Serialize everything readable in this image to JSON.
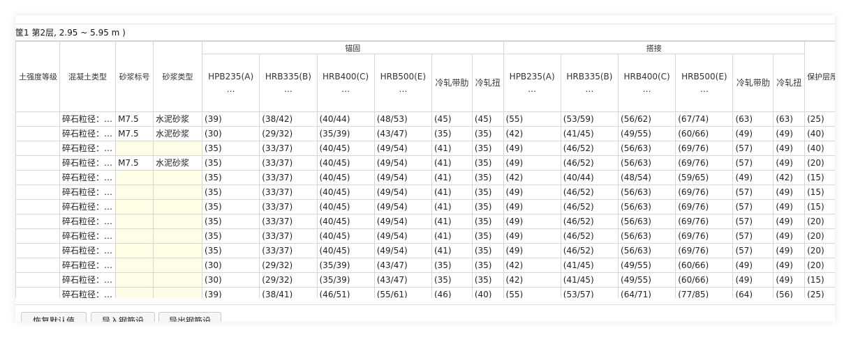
{
  "title": "筐1  第2层, 2.95 ~ 5.95 m )",
  "groups": {
    "anchor": "锚固",
    "lap": "搭接"
  },
  "columns": [
    "土强度等级",
    "混凝土类型",
    "砂浆标号",
    "砂浆类型",
    "HPB235(A)\n…",
    "HRB335(B)\n…",
    "HRB400(C)\n…",
    "HRB500(E)\n…",
    "冷轧带肋",
    "冷轧扭",
    "HPB235(A)\n…",
    "HRB335(B)\n…",
    "HRB400(C)\n…",
    "HRB500(E)\n…",
    "冷轧带肋",
    "冷轧扭",
    "保护层厚度"
  ],
  "rows": [
    [
      "",
      "碎石粒径：…",
      "M7.5",
      "水泥砂浆",
      "(39)",
      "(38/42)",
      "(40/44)",
      "(48/53)",
      "(45)",
      "(45)",
      "(55)",
      "(53/59)",
      "(56/62)",
      "(67/74)",
      "(63)",
      "(63)",
      "(25)"
    ],
    [
      "",
      "碎石粒径：…",
      "M7.5",
      "水泥砂浆",
      "(30)",
      "(29/32)",
      "(35/39)",
      "(43/47)",
      "(35)",
      "(35)",
      "(42)",
      "(41/45)",
      "(49/55)",
      "(60/66)",
      "(49)",
      "(49)",
      "(40)"
    ],
    [
      "",
      "碎石粒径：…",
      "",
      "",
      "(35)",
      "(33/37)",
      "(40/45)",
      "(49/54)",
      "(41)",
      "(35)",
      "(49)",
      "(46/52)",
      "(56/63)",
      "(69/76)",
      "(57)",
      "(49)",
      "(40)"
    ],
    [
      "",
      "碎石粒径：…",
      "M7.5",
      "水泥砂浆",
      "(35)",
      "(33/37)",
      "(40/45)",
      "(49/54)",
      "(41)",
      "(35)",
      "(49)",
      "(46/52)",
      "(56/63)",
      "(69/76)",
      "(57)",
      "(49)",
      "(20)"
    ],
    [
      "",
      "碎石粒径：…",
      "",
      "",
      "(35)",
      "(33/37)",
      "(40/45)",
      "(49/54)",
      "(41)",
      "(35)",
      "(42)",
      "(40/44)",
      "(48/54)",
      "(59/65)",
      "(49)",
      "(42)",
      "(15)"
    ],
    [
      "",
      "碎石粒径：…",
      "",
      "",
      "(35)",
      "(33/37)",
      "(40/45)",
      "(49/54)",
      "(41)",
      "(35)",
      "(49)",
      "(46/52)",
      "(56/63)",
      "(69/76)",
      "(57)",
      "(49)",
      "(15)"
    ],
    [
      "",
      "碎石粒径：…",
      "",
      "",
      "(35)",
      "(33/37)",
      "(40/45)",
      "(49/54)",
      "(41)",
      "(35)",
      "(49)",
      "(46/52)",
      "(56/63)",
      "(69/76)",
      "(57)",
      "(49)",
      "(15)"
    ],
    [
      "",
      "碎石粒径：…",
      "",
      "",
      "(35)",
      "(33/37)",
      "(40/45)",
      "(49/54)",
      "(41)",
      "(35)",
      "(49)",
      "(46/52)",
      "(56/63)",
      "(69/76)",
      "(57)",
      "(49)",
      "(20)"
    ],
    [
      "",
      "碎石粒径：…",
      "",
      "",
      "(35)",
      "(33/37)",
      "(40/45)",
      "(49/54)",
      "(41)",
      "(35)",
      "(49)",
      "(46/52)",
      "(56/63)",
      "(69/76)",
      "(57)",
      "(49)",
      "(20)"
    ],
    [
      "",
      "碎石粒径：…",
      "",
      "",
      "(35)",
      "(33/37)",
      "(40/45)",
      "(49/54)",
      "(41)",
      "(35)",
      "(49)",
      "(46/52)",
      "(56/63)",
      "(69/76)",
      "(57)",
      "(49)",
      "(20)"
    ],
    [
      "",
      "碎石粒径：…",
      "",
      "",
      "(30)",
      "(29/32)",
      "(35/39)",
      "(43/47)",
      "(35)",
      "(35)",
      "(42)",
      "(41/45)",
      "(49/55)",
      "(60/66)",
      "(49)",
      "(49)",
      "(20)"
    ],
    [
      "",
      "碎石粒径：…",
      "",
      "",
      "(30)",
      "(29/32)",
      "(35/39)",
      "(43/47)",
      "(35)",
      "(35)",
      "(42)",
      "(41/45)",
      "(49/55)",
      "(60/66)",
      "(49)",
      "(49)",
      "(15)"
    ],
    [
      "",
      "碎石粒径：…",
      "",
      "",
      "(39)",
      "(38/41)",
      "(46/51)",
      "(55/61)",
      "(46)",
      "(40)",
      "(55)",
      "(53/57)",
      "(64/71)",
      "(77/85)",
      "(64)",
      "(56)",
      "(25)"
    ]
  ],
  "buttons": {
    "restore": "恢复默认值(D)",
    "import": "导入钢筋设置",
    "export": "导出钢筋设置"
  }
}
